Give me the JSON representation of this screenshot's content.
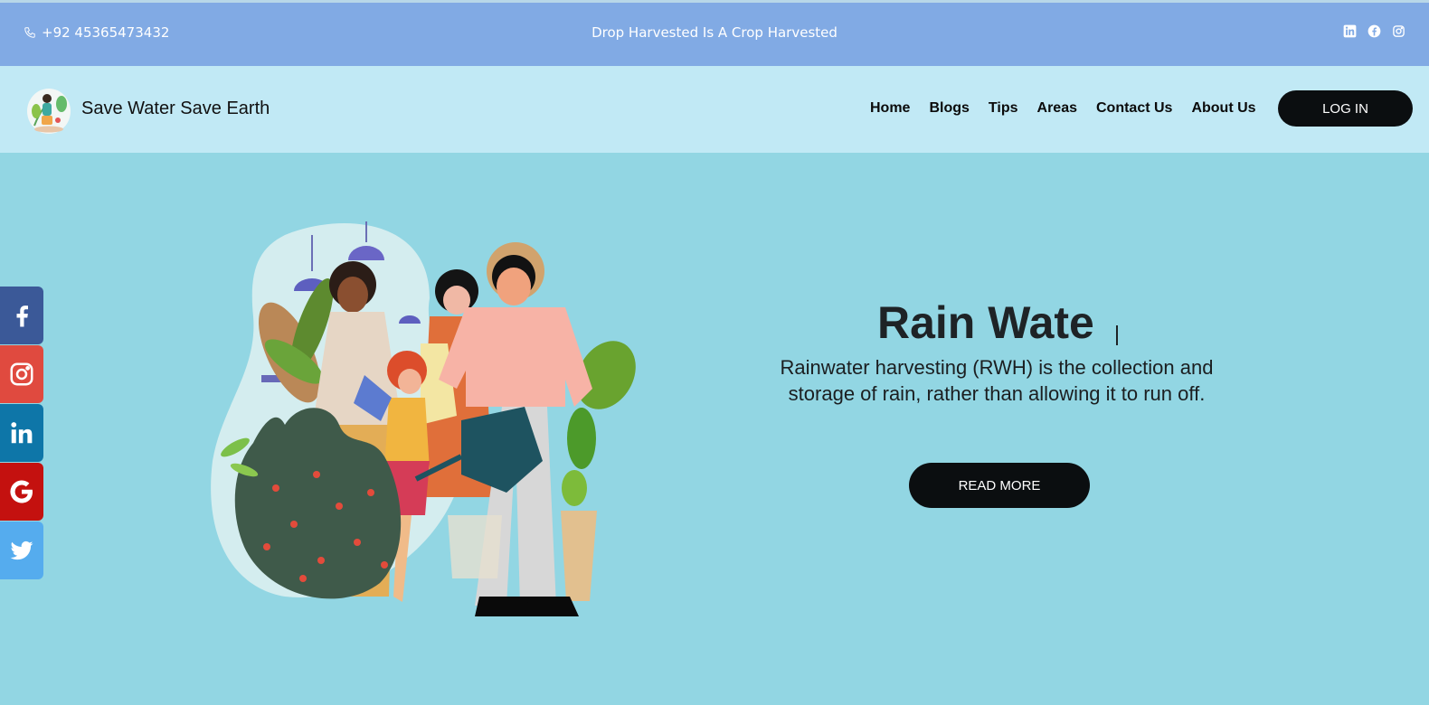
{
  "topbar": {
    "phone": "+92 45365473432",
    "tagline": "Drop Harvested Is A Crop Harvested",
    "socials": [
      "linkedin-icon",
      "facebook-icon",
      "instagram-icon"
    ]
  },
  "nav": {
    "brand": "Save Water Save Earth",
    "items": [
      "Home",
      "Blogs",
      "Tips",
      "Areas",
      "Contact Us",
      "About Us"
    ],
    "login": "LOG IN"
  },
  "side_social": [
    {
      "icon": "facebook-icon",
      "color": "#3b5998"
    },
    {
      "icon": "instagram-icon",
      "color": "#e04a3f"
    },
    {
      "icon": "linkedin-icon",
      "color": "#0e76a8"
    },
    {
      "icon": "google-icon",
      "color": "#c4110f"
    },
    {
      "icon": "twitter-icon",
      "color": "#55acee"
    }
  ],
  "hero": {
    "title": "Rain Wate",
    "text": "Rainwater harvesting (RWH) is the collection and storage of rain, rather than allowing it to run off.",
    "button": "READ MORE"
  },
  "colors": {
    "topbar": "#81aae4",
    "navbar": "#c1e9f5",
    "hero_bg": "#92d6e3",
    "button": "#0b0e10"
  }
}
